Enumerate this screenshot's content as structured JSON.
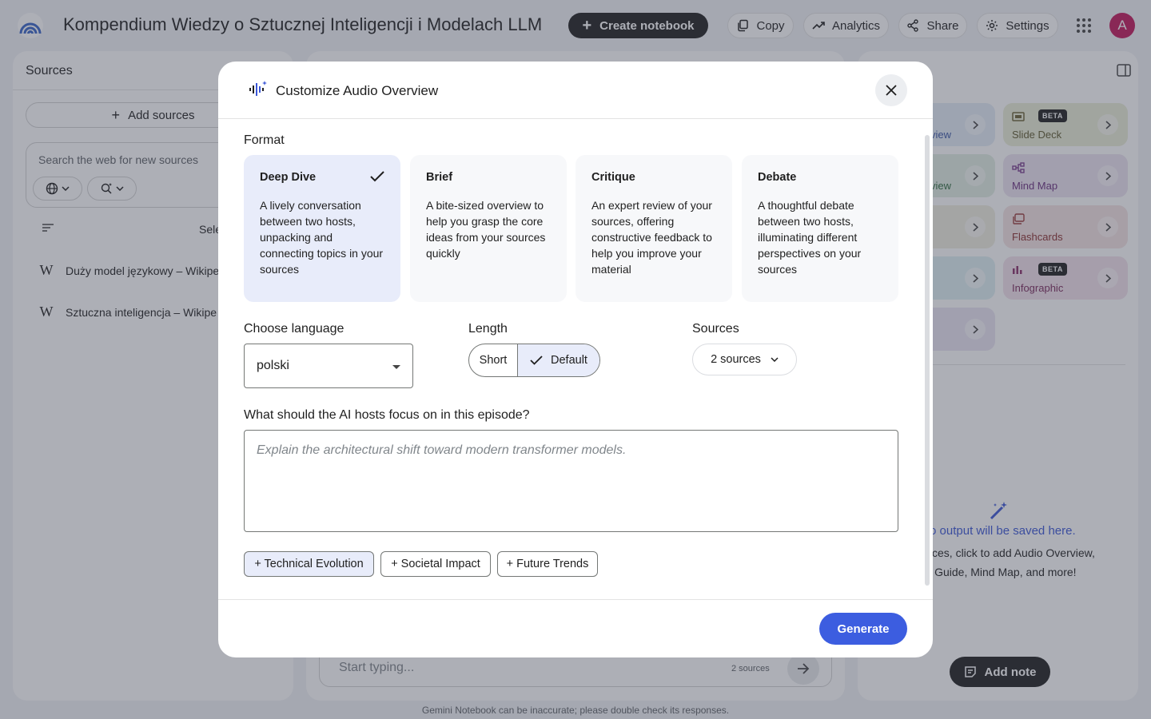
{
  "header": {
    "notebook_title": "Kompendium Wiedzy o Sztucznej Inteligencji i Modelach LLM",
    "create_label": "Create notebook",
    "copy_label": "Copy",
    "analytics_label": "Analytics",
    "share_label": "Share",
    "settings_label": "Settings",
    "avatar_initial": "A"
  },
  "sources": {
    "title": "Sources",
    "add_label": "Add sources",
    "search_placeholder": "Search the web for new sources",
    "select_all_label": "Sele",
    "items": [
      {
        "label": "Duży model językowy – Wikipe"
      },
      {
        "label": "Sztuczna inteligencja – Wikipe"
      }
    ]
  },
  "chat": {
    "input_placeholder": "Start typing...",
    "source_count": "2 sources",
    "disclaimer": "Gemini Notebook can be inaccurate; please double check its responses."
  },
  "studio": {
    "tiles": [
      {
        "label": "view",
        "partial": true
      },
      {
        "label": "Slide Deck",
        "badge": "BETA"
      },
      {
        "label": "view",
        "partial": true
      },
      {
        "label": "Mind Map"
      },
      {
        "label": "",
        "partial": true
      },
      {
        "label": "Flashcards"
      },
      {
        "label": "",
        "partial": true
      },
      {
        "label": "Infographic",
        "badge": "BETA"
      },
      {
        "label": "",
        "partial": true
      }
    ],
    "empty_title": "dio output will be saved here.",
    "empty_line1": "g sources, click to add Audio Overview,",
    "empty_line2": "dy Guide, Mind Map, and more!",
    "add_note_label": "Add note"
  },
  "modal": {
    "title": "Customize Audio Overview",
    "format_label": "Format",
    "formats": [
      {
        "title": "Deep Dive",
        "desc": "A lively conversation between two hosts, unpacking and connecting topics in your sources",
        "selected": true
      },
      {
        "title": "Brief",
        "desc": "A bite-sized overview to help you grasp the core ideas from your sources quickly",
        "selected": false
      },
      {
        "title": "Critique",
        "desc": "An expert review of your sources, offering constructive feedback to help you improve your material",
        "selected": false
      },
      {
        "title": "Debate",
        "desc": "A thoughtful debate between two hosts, illuminating different perspectives on your sources",
        "selected": false
      }
    ],
    "language_label": "Choose language",
    "language_value": "polski",
    "length_label": "Length",
    "length_options": [
      "Short",
      "Default"
    ],
    "length_selected": "Default",
    "sources_label": "Sources",
    "sources_value": "2 sources",
    "focus_label": "What should the AI hosts focus on in this episode?",
    "focus_placeholder": "Explain the architectural shift toward modern transformer models.",
    "focus_value": "",
    "suggestions": [
      {
        "label": "+ Technical Evolution",
        "active": true
      },
      {
        "label": "+ Societal Impact",
        "active": false
      },
      {
        "label": "+ Future Trends",
        "active": false
      }
    ],
    "generate_label": "Generate"
  },
  "colors": {
    "accent": "#3c5de0",
    "selected_bg": "#e8ecfa",
    "dark_button": "#1f1f1f",
    "avatar": "#c2185b",
    "overlay": "rgba(60,64,82,0.42)"
  }
}
